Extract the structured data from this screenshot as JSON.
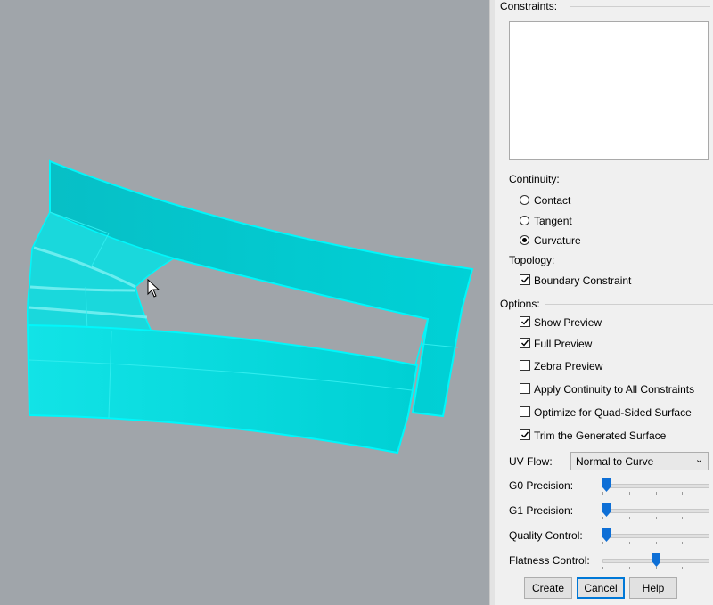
{
  "constraints_label": "Constraints:",
  "continuity": {
    "label": "Continuity:",
    "options": [
      "Contact",
      "Tangent",
      "Curvature"
    ],
    "selected": "Curvature"
  },
  "topology": {
    "label": "Topology:",
    "boundary_constraint": {
      "label": "Boundary Constraint",
      "checked": true
    }
  },
  "options": {
    "label": "Options:",
    "items": [
      {
        "label": "Show Preview",
        "checked": true
      },
      {
        "label": "Full Preview",
        "checked": true
      },
      {
        "label": "Zebra Preview",
        "checked": false
      },
      {
        "label": "Apply Continuity to All Constraints",
        "checked": false
      },
      {
        "label": "Optimize for Quad-Sided Surface",
        "checked": false
      },
      {
        "label": "Trim the Generated Surface",
        "checked": true
      }
    ]
  },
  "uv_flow": {
    "label": "UV Flow:",
    "value": "Normal to Curve"
  },
  "sliders": [
    {
      "label": "G0 Precision:",
      "value": 0.0
    },
    {
      "label": "G1 Precision:",
      "value": 0.0
    },
    {
      "label": "Quality Control:",
      "value": 0.0
    },
    {
      "label": "Flatness Control:",
      "value": 0.5
    }
  ],
  "buttons": {
    "create": "Create",
    "cancel": "Cancel",
    "help": "Help"
  },
  "colors": {
    "surface": "#00cdd2",
    "edge": "#00fbff",
    "viewport_bg": "#a0a5aa",
    "accent": "#0e6fd6"
  }
}
